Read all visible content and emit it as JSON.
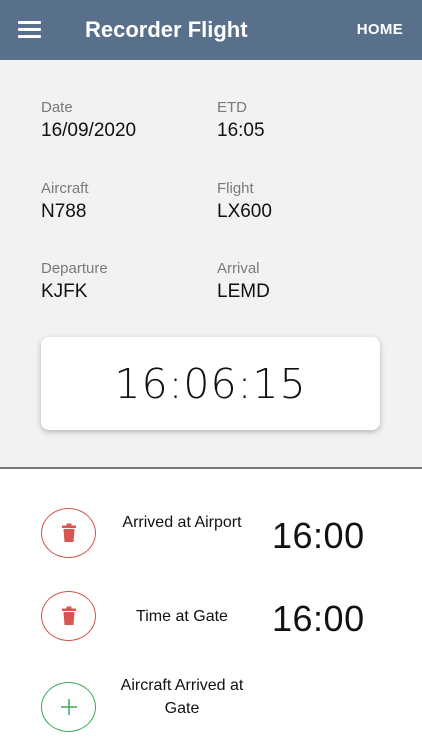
{
  "app_bar": {
    "title": "Recorder Flight",
    "home_label": "HOME",
    "color": "#58708c"
  },
  "flight_info": {
    "date": {
      "label": "Date",
      "value": "16/09/2020"
    },
    "etd": {
      "label": "ETD",
      "value": "16:05"
    },
    "aircraft": {
      "label": "Aircraft",
      "value": "N788"
    },
    "flight": {
      "label": "Flight",
      "value": "LX600"
    },
    "departure": {
      "label": "Departure",
      "value": "KJFK"
    },
    "arrival": {
      "label": "Arrival",
      "value": "LEMD"
    }
  },
  "clock": {
    "time": "16:06:15"
  },
  "events": [
    {
      "label": "Arrived at Airport",
      "time": "16:00",
      "action": "delete",
      "icon": "trash-icon"
    },
    {
      "label": "Time at Gate",
      "time": "16:00",
      "action": "delete",
      "icon": "trash-icon"
    },
    {
      "label": "Aircraft Arrived at Gate",
      "time": "",
      "action": "add",
      "icon": "plus-icon"
    }
  ],
  "colors": {
    "delete": "#d9534f",
    "add": "#3daa5c"
  }
}
